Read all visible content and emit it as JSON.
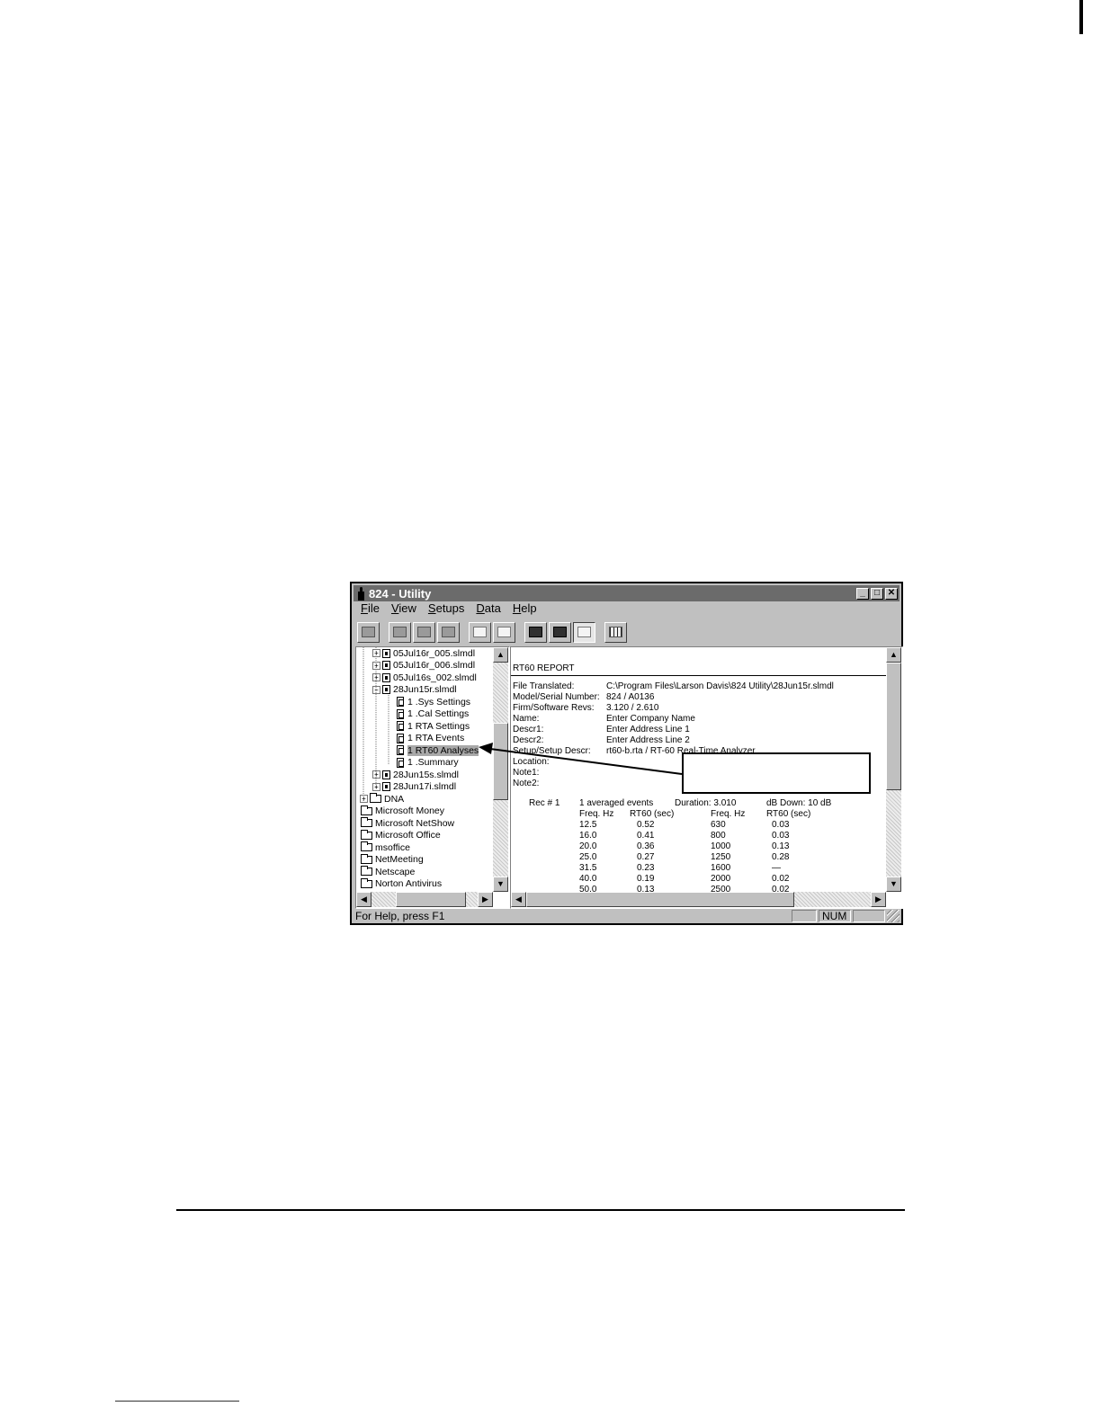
{
  "window": {
    "title": "824 - Utility"
  },
  "menu": [
    {
      "accel": "F",
      "rest": "ile"
    },
    {
      "accel": "V",
      "rest": "iew"
    },
    {
      "accel": "S",
      "rest": "etups"
    },
    {
      "accel": "D",
      "rest": "ata"
    },
    {
      "accel": "H",
      "rest": "elp"
    }
  ],
  "tree": {
    "items": [
      {
        "label": "05Jul16r_005.slmdl",
        "kind": "file",
        "expander": "+"
      },
      {
        "label": "05Jul16r_006.slmdl",
        "kind": "file",
        "expander": "+"
      },
      {
        "label": "05Jul16s_002.slmdl",
        "kind": "file",
        "expander": "+"
      },
      {
        "label": "28Jun15r.slmdl",
        "kind": "file",
        "expander": "-"
      },
      {
        "label": "1 .Sys Settings",
        "kind": "doc"
      },
      {
        "label": "1 .Cal Settings",
        "kind": "doc"
      },
      {
        "label": "1 RTA Settings",
        "kind": "doc"
      },
      {
        "label": "1 RTA Events",
        "kind": "doc"
      },
      {
        "label": "1 RT60 Analyses",
        "kind": "doc",
        "selected": true
      },
      {
        "label": "1 .Summary",
        "kind": "doc"
      },
      {
        "label": "28Jun15s.slmdl",
        "kind": "file",
        "expander": "+"
      },
      {
        "label": "28Jun17i.slmdl",
        "kind": "file",
        "expander": "+"
      },
      {
        "label": "DNA",
        "kind": "folder",
        "expander": "+"
      },
      {
        "label": "Microsoft Money",
        "kind": "folder"
      },
      {
        "label": "Microsoft NetShow",
        "kind": "folder"
      },
      {
        "label": "Microsoft Office",
        "kind": "folder"
      },
      {
        "label": "msoffice",
        "kind": "folder"
      },
      {
        "label": "NetMeeting",
        "kind": "folder"
      },
      {
        "label": "Netscape",
        "kind": "folder"
      },
      {
        "label": "Norton Antivirus",
        "kind": "folder"
      }
    ]
  },
  "report": {
    "title": "RT60 REPORT",
    "fields": [
      {
        "label": "File Translated:",
        "value": "C:\\Program Files\\Larson Davis\\824 Utility\\28Jun15r.slmdl"
      },
      {
        "label": "Model/Serial Number:",
        "value": "824 / A0136"
      },
      {
        "label": "Firm/Software Revs:",
        "value": "3.120 / 2.610"
      },
      {
        "label": "Name:",
        "value": "Enter Company Name"
      },
      {
        "label": "Descr1:",
        "value": "Enter Address Line 1"
      },
      {
        "label": "Descr2:",
        "value": "Enter Address Line 2"
      },
      {
        "label": "Setup/Setup Descr:",
        "value": "rt60-b.rta / RT-60 Real-Time Analyzer"
      },
      {
        "label": "Location:",
        "value": ""
      },
      {
        "label": "Note1:",
        "value": ""
      },
      {
        "label": "Note2:",
        "value": ""
      }
    ],
    "rec_label": "Rec # 1",
    "events": "1 averaged events",
    "duration": "Duration: 3.010",
    "db_down": "dB Down: 10 dB",
    "headers": [
      "Freq. Hz",
      "RT60 (sec)",
      "Freq. Hz",
      "RT60 (sec)"
    ],
    "rows": [
      [
        "12.5",
        "0.52",
        "630",
        "0.03"
      ],
      [
        "16.0",
        "0.41",
        "800",
        "0.03"
      ],
      [
        "20.0",
        "0.36",
        "1000",
        "0.13"
      ],
      [
        "25.0",
        "0.27",
        "1250",
        "0.28"
      ],
      [
        "31.5",
        "0.23",
        "1600",
        "—"
      ],
      [
        "40.0",
        "0.19",
        "2000",
        "0.02"
      ],
      [
        "50.0",
        "0.13",
        "2500",
        "0.02"
      ]
    ]
  },
  "status": {
    "help": "For Help, press F1",
    "num": "NUM"
  }
}
